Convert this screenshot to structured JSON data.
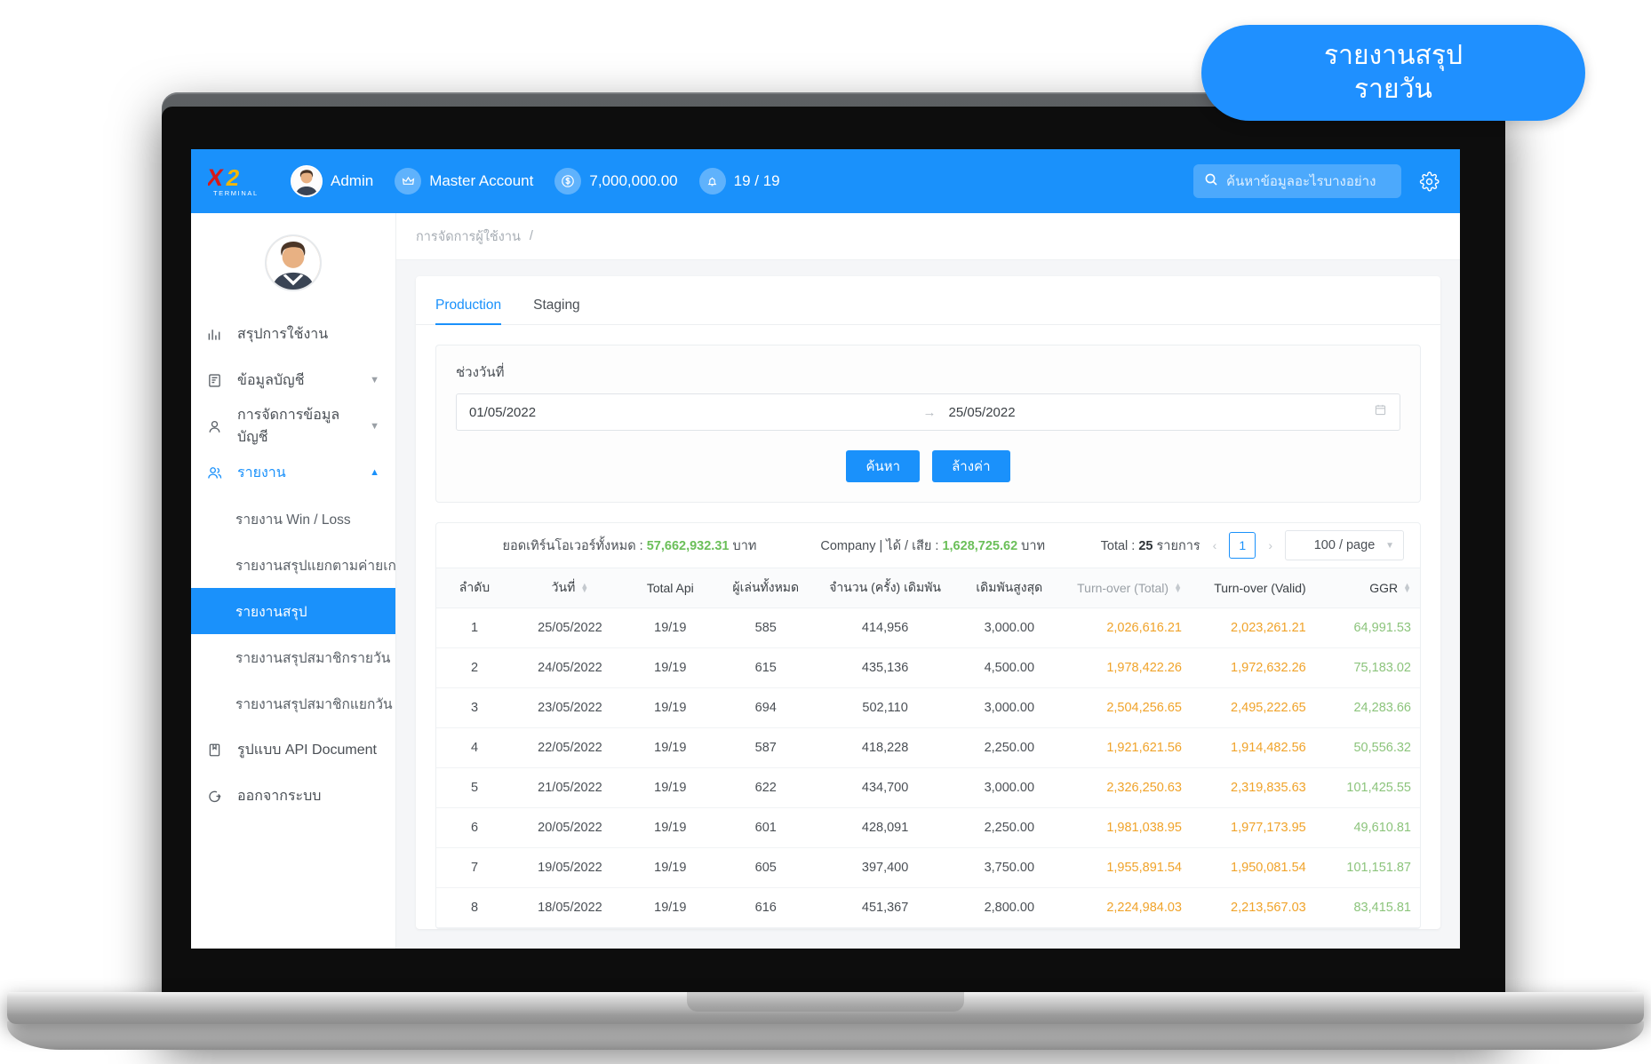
{
  "callout": {
    "line1": "รายงานสรุป",
    "line2": "รายวัน"
  },
  "header": {
    "logo_text": "X2",
    "logo_sub": "TERMINAL",
    "user_name": "Admin",
    "account_label": "Master Account",
    "balance": "7,000,000.00",
    "api_count": "19 / 19",
    "search_placeholder": "ค้นหาข้อมูลอะไรบางอย่าง"
  },
  "sidebar": {
    "items": [
      {
        "label": "สรุปการใช้งาน",
        "icon": "bar-chart-icon",
        "type": "item"
      },
      {
        "label": "ข้อมูลบัญชี",
        "icon": "file-list-icon",
        "type": "expandable"
      },
      {
        "label": "การจัดการข้อมูลบัญชี",
        "icon": "user-icon",
        "type": "expandable"
      },
      {
        "label": "รายงาน",
        "icon": "users-icon",
        "type": "expandable",
        "active": true
      }
    ],
    "sub_items": [
      {
        "label": "รายงาน Win / Loss"
      },
      {
        "label": "รายงานสรุปแยกตามค่ายเกม"
      },
      {
        "label": "รายงานสรุป",
        "active": true
      },
      {
        "label": "รายงานสรุปสมาชิกรายวัน"
      },
      {
        "label": "รายงานสรุปสมาชิกแยกวัน"
      }
    ],
    "footer_items": [
      {
        "label": "รูปแบบ API Document",
        "icon": "book-icon"
      },
      {
        "label": "ออกจากระบบ",
        "icon": "logout-icon"
      }
    ]
  },
  "breadcrumb": {
    "label": "การจัดการผู้ใช้งาน",
    "separator": "/"
  },
  "tabs": [
    {
      "label": "Production",
      "active": true
    },
    {
      "label": "Staging",
      "active": false
    }
  ],
  "filter": {
    "range_label": "ช่วงวันที่",
    "date_from": "01/05/2022",
    "date_to": "25/05/2022",
    "range_arrow": "→",
    "search_button": "ค้นหา",
    "clear_button": "ล้างค่า"
  },
  "summary": {
    "turnover_label": "ยอดเทิร์นโอเวอร์ทั้งหมด :",
    "turnover_value": "57,662,932.31",
    "turnover_unit": "บาท",
    "company_label": "Company | ได้ / เสีย :",
    "company_value": "1,628,725.62",
    "company_unit": "บาท",
    "total_prefix": "Total :",
    "total_count": "25",
    "total_suffix": "รายการ",
    "page_current": "1",
    "prev_arrow": "‹",
    "next_arrow": "›",
    "per_page": "100 / page"
  },
  "table": {
    "columns": [
      {
        "label": "ลำดับ",
        "sortable": false
      },
      {
        "label": "วันที่",
        "sortable": true
      },
      {
        "label": "Total Api",
        "sortable": false
      },
      {
        "label": "ผู้เล่นทั้งหมด",
        "sortable": false
      },
      {
        "label": "จำนวน (ครั้ง) เดิมพัน",
        "sortable": false
      },
      {
        "label": "เดิมพันสูงสุด",
        "sortable": false
      },
      {
        "label": "Turn-over (Total)",
        "sortable": true
      },
      {
        "label": "Turn-over (Valid)",
        "sortable": false
      },
      {
        "label": "GGR",
        "sortable": true
      }
    ],
    "rows": [
      {
        "no": "1",
        "date": "25/05/2022",
        "api": "19/19",
        "players": "585",
        "bets": "414,956",
        "max_bet": "3,000.00",
        "to_total": "2,026,616.21",
        "to_valid": "2,023,261.21",
        "ggr": "64,991.53"
      },
      {
        "no": "2",
        "date": "24/05/2022",
        "api": "19/19",
        "players": "615",
        "bets": "435,136",
        "max_bet": "4,500.00",
        "to_total": "1,978,422.26",
        "to_valid": "1,972,632.26",
        "ggr": "75,183.02"
      },
      {
        "no": "3",
        "date": "23/05/2022",
        "api": "19/19",
        "players": "694",
        "bets": "502,110",
        "max_bet": "3,000.00",
        "to_total": "2,504,256.65",
        "to_valid": "2,495,222.65",
        "ggr": "24,283.66"
      },
      {
        "no": "4",
        "date": "22/05/2022",
        "api": "19/19",
        "players": "587",
        "bets": "418,228",
        "max_bet": "2,250.00",
        "to_total": "1,921,621.56",
        "to_valid": "1,914,482.56",
        "ggr": "50,556.32"
      },
      {
        "no": "5",
        "date": "21/05/2022",
        "api": "19/19",
        "players": "622",
        "bets": "434,700",
        "max_bet": "3,000.00",
        "to_total": "2,326,250.63",
        "to_valid": "2,319,835.63",
        "ggr": "101,425.55"
      },
      {
        "no": "6",
        "date": "20/05/2022",
        "api": "19/19",
        "players": "601",
        "bets": "428,091",
        "max_bet": "2,250.00",
        "to_total": "1,981,038.95",
        "to_valid": "1,977,173.95",
        "ggr": "49,610.81"
      },
      {
        "no": "7",
        "date": "19/05/2022",
        "api": "19/19",
        "players": "605",
        "bets": "397,400",
        "max_bet": "3,750.00",
        "to_total": "1,955,891.54",
        "to_valid": "1,950,081.54",
        "ggr": "101,151.87"
      },
      {
        "no": "8",
        "date": "18/05/2022",
        "api": "19/19",
        "players": "616",
        "bets": "451,367",
        "max_bet": "2,800.00",
        "to_total": "2,224,984.03",
        "to_valid": "2,213,567.03",
        "ggr": "83,415.81"
      }
    ]
  },
  "colors": {
    "brand_blue": "#1a91fb",
    "orange": "#f0a32a",
    "green": "#8cc47c",
    "summary_green": "#6bbf59"
  }
}
